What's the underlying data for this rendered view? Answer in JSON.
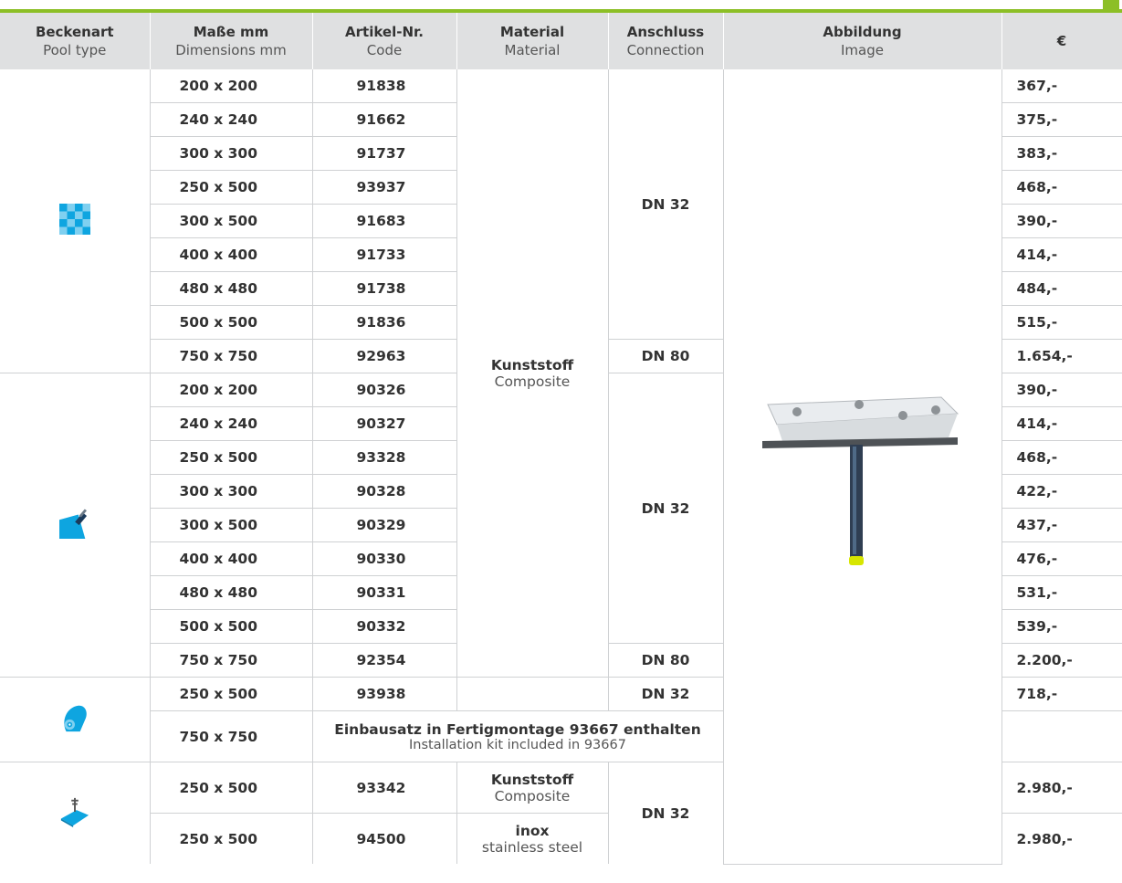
{
  "header": {
    "columns": [
      {
        "de": "Beckenart",
        "en": "Pool type"
      },
      {
        "de": "Maße mm",
        "en": "Dimensions mm"
      },
      {
        "de": "Artikel-Nr.",
        "en": "Code"
      },
      {
        "de": "Material",
        "en": "Material"
      },
      {
        "de": "Anschluss",
        "en": "Connection"
      },
      {
        "de": "Abbildung",
        "en": "Image"
      },
      {
        "de": "€",
        "en": ""
      }
    ]
  },
  "groups": {
    "tiled": {
      "icon": "tiled-pool-icon",
      "rows": [
        {
          "dim": "200 x 200",
          "code": "91838",
          "price": "367,-"
        },
        {
          "dim": "240 x 240",
          "code": "91662",
          "price": "375,-"
        },
        {
          "dim": "300 x 300",
          "code": "91737",
          "price": "383,-"
        },
        {
          "dim": "250 x 500",
          "code": "93937",
          "price": "468,-"
        },
        {
          "dim": "300 x 500",
          "code": "91683",
          "price": "390,-"
        },
        {
          "dim": "400 x 400",
          "code": "91733",
          "price": "414,-"
        },
        {
          "dim": "480 x 480",
          "code": "91738",
          "price": "484,-"
        },
        {
          "dim": "500 x 500",
          "code": "91836",
          "price": "515,-"
        },
        {
          "dim": "750 x 750",
          "code": "92963",
          "price": "1.654,-"
        }
      ],
      "connection_main": "DN 32",
      "connection_last": "DN 80"
    },
    "painted": {
      "icon": "paint-brush-pool-icon",
      "rows": [
        {
          "dim": "200 x 200",
          "code": "90326",
          "price": "390,-"
        },
        {
          "dim": "240 x 240",
          "code": "90327",
          "price": "414,-"
        },
        {
          "dim": "250 x 500",
          "code": "93328",
          "price": "468,-"
        },
        {
          "dim": "300 x 300",
          "code": "90328",
          "price": "422,-"
        },
        {
          "dim": "300 x 500",
          "code": "90329",
          "price": "437,-"
        },
        {
          "dim": "400 x 400",
          "code": "90330",
          "price": "476,-"
        },
        {
          "dim": "480 x 480",
          "code": "90331",
          "price": "531,-"
        },
        {
          "dim": "500 x 500",
          "code": "90332",
          "price": "539,-"
        },
        {
          "dim": "750 x 750",
          "code": "92354",
          "price": "2.200,-"
        }
      ],
      "connection_main": "DN 32",
      "connection_last": "DN 80"
    },
    "foil": {
      "icon": "foil-roll-pool-icon",
      "row1": {
        "dim": "250 x 500",
        "code": "93938",
        "connection": "DN 32",
        "price": "718,-"
      },
      "row2": {
        "dim": "750 x 750",
        "note_de": "Einbausatz in Fertigmontage 93667 enthalten",
        "note_en": "Installation kit included in 93667"
      }
    },
    "steel": {
      "icon": "steel-pool-icon",
      "row1": {
        "dim": "250 x 500",
        "code": "93342",
        "mat_de": "Kunststoff",
        "mat_en": "Composite",
        "price": "2.980,-"
      },
      "row2": {
        "dim": "250 x 500",
        "code": "94500",
        "mat_de": "inox",
        "mat_en": "stainless steel",
        "price": "2.980,-"
      },
      "connection": "DN 32"
    }
  },
  "material_main": {
    "de": "Kunststoff",
    "en": "Composite"
  },
  "colors": {
    "accent": "#8cbf26",
    "header_bg": "#dfe0e1",
    "icon_blue": "#0ea5e0"
  }
}
